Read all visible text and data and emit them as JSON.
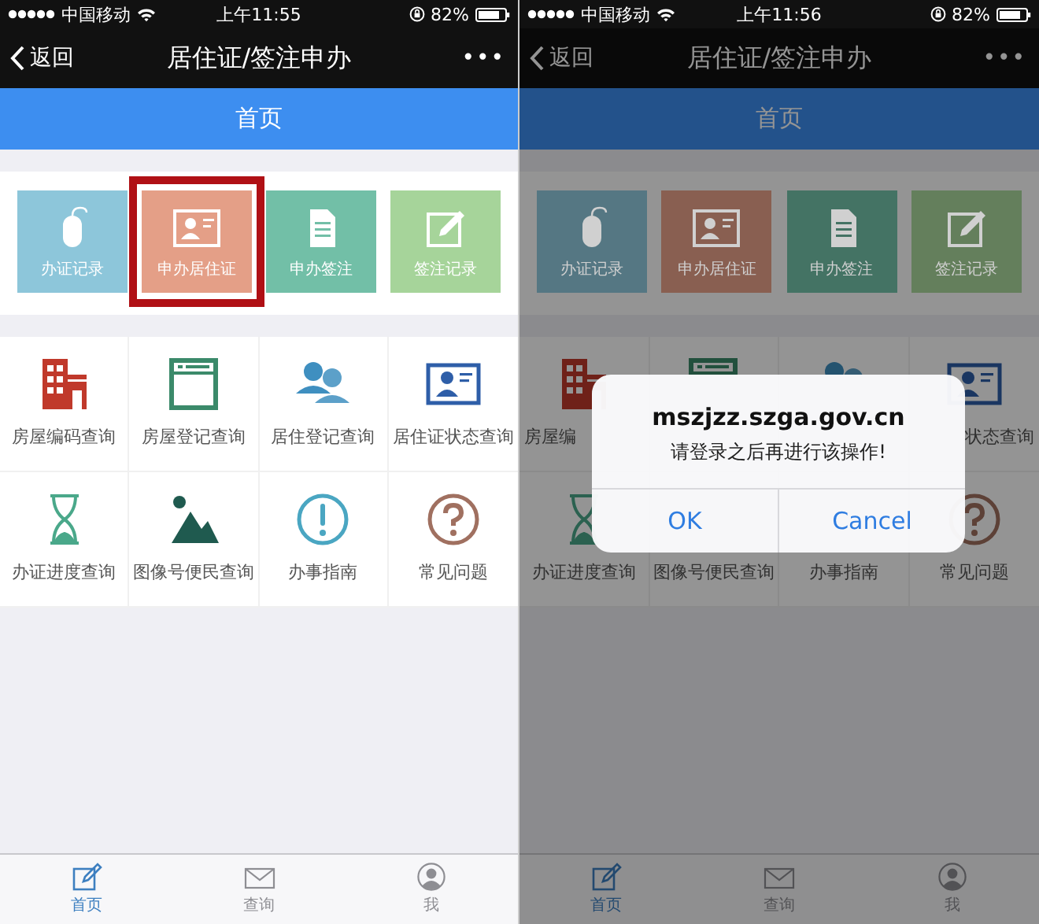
{
  "screens": [
    {
      "status_bar": {
        "carrier": "中国移动",
        "time": "上午11:55",
        "battery": "82%"
      },
      "nav": {
        "back": "返回",
        "title": "居住证/签注申办",
        "more": "•••"
      },
      "header": {
        "title": "首页"
      },
      "tiles": [
        {
          "label": "办证记录",
          "kind": "mouse",
          "color": "#8dc6da",
          "highlighted": false
        },
        {
          "label": "申办居住证",
          "kind": "card",
          "color": "#e49f87",
          "highlighted": true
        },
        {
          "label": "申办签注",
          "kind": "document",
          "color": "#72bfa7",
          "highlighted": false
        },
        {
          "label": "签注记录",
          "kind": "edit",
          "color": "#a6d49a",
          "highlighted": false
        }
      ],
      "services": [
        {
          "label": "房屋编码查询",
          "kind": "building"
        },
        {
          "label": "房屋登记查询",
          "kind": "window"
        },
        {
          "label": "居住登记查询",
          "kind": "people"
        },
        {
          "label": "居住证状态查询",
          "kind": "card"
        },
        {
          "label": "办证进度查询",
          "kind": "hourglass"
        },
        {
          "label": "图像号便民查询",
          "kind": "image"
        },
        {
          "label": "办事指南",
          "kind": "info"
        },
        {
          "label": "常见问题",
          "kind": "question"
        }
      ],
      "tab_bar": [
        {
          "label": "首页",
          "kind": "edit",
          "selected": true
        },
        {
          "label": "查询",
          "kind": "mail",
          "selected": false
        },
        {
          "label": "我",
          "kind": "user",
          "selected": false
        }
      ],
      "dimmed": false
    },
    {
      "status_bar": {
        "carrier": "中国移动",
        "time": "上午11:56",
        "battery": "82%"
      },
      "nav": {
        "back": "返回",
        "title": "居住证/签注申办",
        "more": "•••"
      },
      "header": {
        "title": "首页"
      },
      "tiles": [
        {
          "label": "办证记录",
          "kind": "mouse",
          "color": "#557783",
          "highlighted": false
        },
        {
          "label": "申办居住证",
          "kind": "card",
          "color": "#895f51",
          "highlighted": false
        },
        {
          "label": "申办签注",
          "kind": "document",
          "color": "#447364",
          "highlighted": false
        },
        {
          "label": "签注记录",
          "kind": "edit",
          "color": "#647f5c",
          "highlighted": false
        }
      ],
      "services": [
        {
          "label": "房屋编",
          "kind": "building"
        },
        {
          "kind": "window"
        },
        {
          "kind": "people"
        },
        {
          "label": "状态查询",
          "kind": "card"
        },
        {
          "label": "办证进度查询",
          "kind": "hourglass"
        },
        {
          "label": "图像号便民查询"
        },
        {
          "label": "办事指南"
        },
        {
          "label": "常见问题",
          "kind": "question"
        }
      ],
      "tab_bar": [
        {
          "label": "首页",
          "kind": "edit",
          "selected": true
        },
        {
          "label": "查询",
          "kind": "mail",
          "selected": false
        },
        {
          "label": "我",
          "kind": "user",
          "selected": false
        }
      ],
      "dimmed": true,
      "dialog": {
        "title": "mszjzz.szga.gov.cn",
        "message": "请登录之后再进行该操作!",
        "buttons": [
          "OK",
          "Cancel"
        ]
      }
    }
  ]
}
